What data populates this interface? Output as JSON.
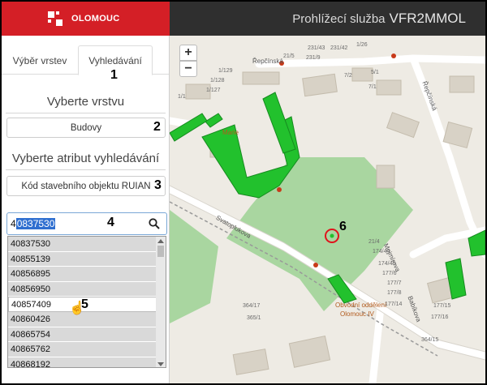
{
  "header": {
    "brand": "OLOMOUC",
    "title_prefix": "Prohlížecí služba",
    "title_main": "VFR2MMOL"
  },
  "sidebar": {
    "tabs": [
      "Výběr vrstev",
      "Vyhledávání"
    ],
    "layer_title": "Vyberte vrstvu",
    "layer_value": "Budovy",
    "attr_title": "Vyberte atribut vyhledávání",
    "attr_value": "Kód stavebního objektu RUIAN",
    "search": {
      "typed": "4",
      "selected": "0837530"
    },
    "suggestions": [
      "40837530",
      "40855139",
      "40856895",
      "40856950",
      "40857409",
      "40860426",
      "40865754",
      "40865762",
      "40868192"
    ],
    "active_index": 4
  },
  "map": {
    "zoom_in": "+",
    "zoom_out": "−",
    "streets": [
      "Řepčínská",
      "Svatoplukova",
      "Mojmírova",
      "Babíkova",
      "Řepčínská"
    ],
    "labels": [
      "Marie",
      "Obvodní oddělení",
      "Olomouc IV"
    ],
    "numbers": [
      "231/43",
      "231/42",
      "231/9",
      "1/129",
      "1/128",
      "1/127",
      "1/1",
      "1/26",
      "7/1",
      "7/2",
      "5/1",
      "21/5",
      "21/4",
      "174/44",
      "174/45",
      "177/6",
      "177/7",
      "177/8",
      "177/14",
      "177/15",
      "177/16",
      "364/15",
      "364/17",
      "365/1"
    ]
  },
  "markers": [
    "1",
    "2",
    "3",
    "4",
    "5",
    "6"
  ],
  "colors": {
    "brand_red": "#d41f26",
    "titlebar": "#2f2f2f",
    "park_green": "#9ccf94",
    "building_green": "#22c12d",
    "poi_red": "#c83a1a"
  }
}
